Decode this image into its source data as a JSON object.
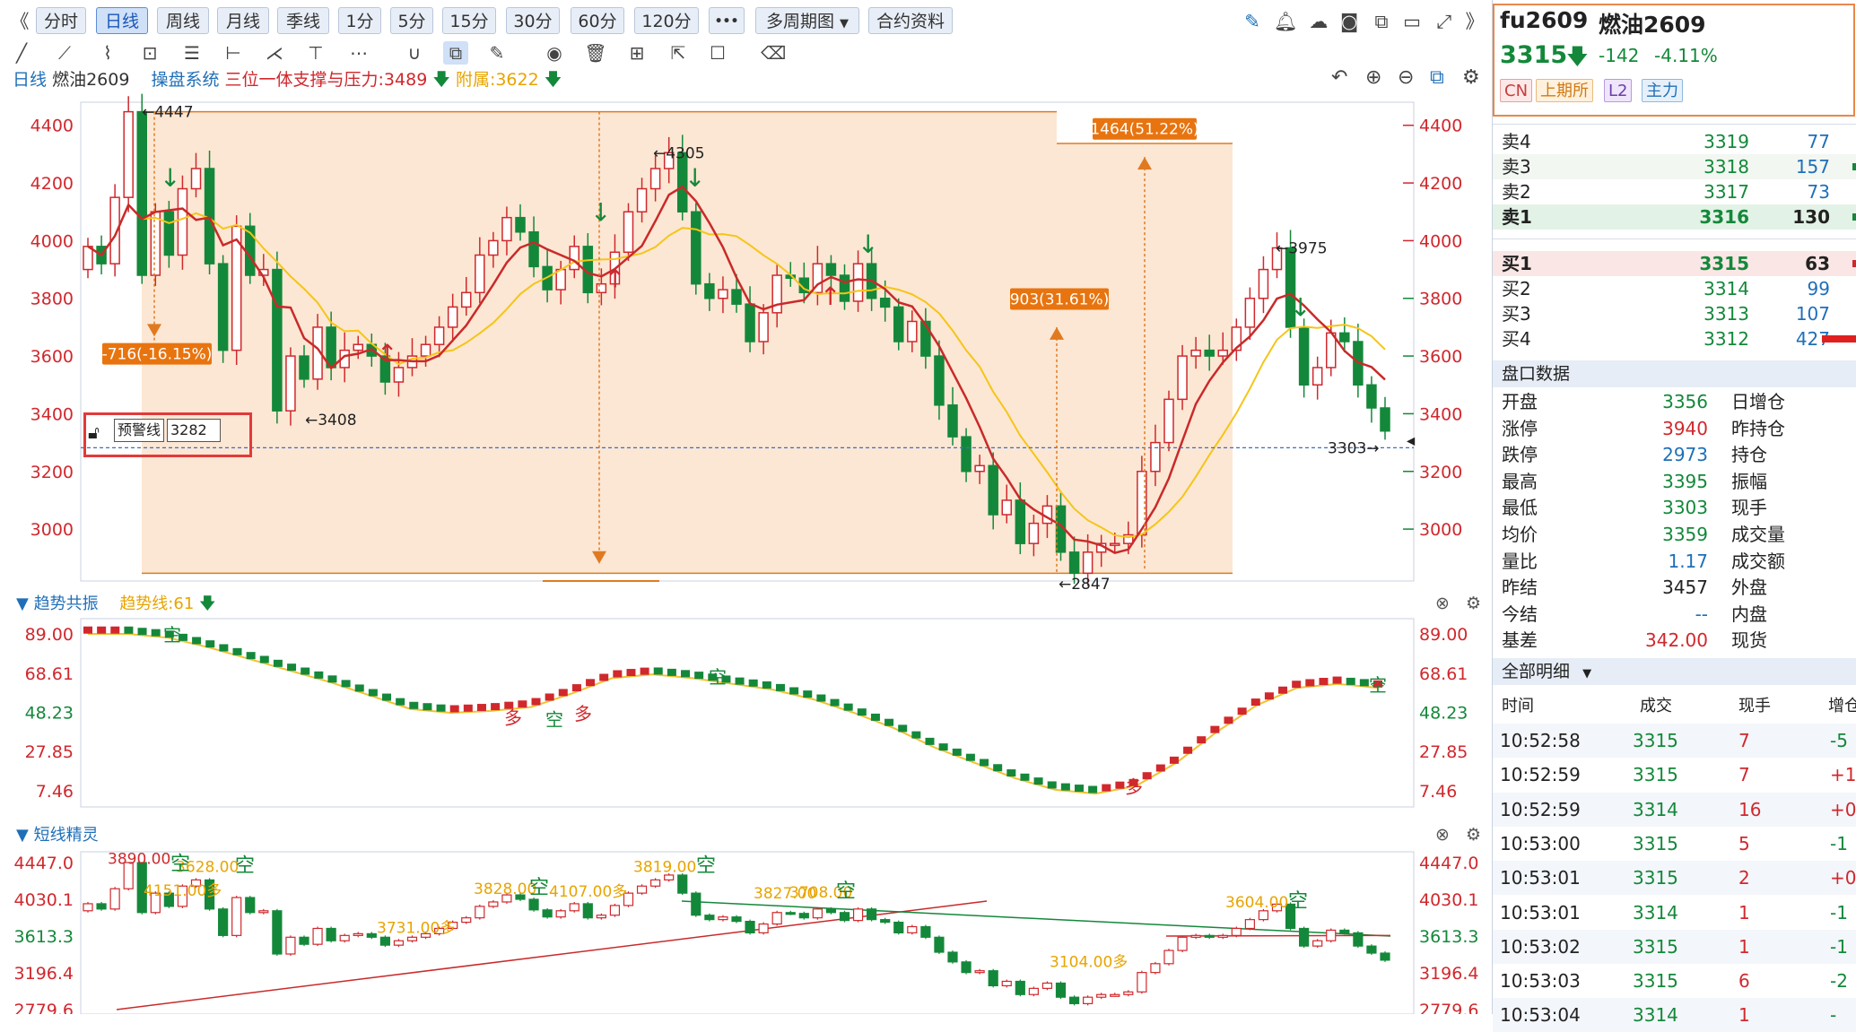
{
  "toolbar": {
    "collapse": "《",
    "periods": [
      "分时",
      "日线",
      "周线",
      "月线",
      "季线",
      "1分",
      "5分",
      "15分",
      "30分",
      "60分",
      "120分"
    ],
    "more": "•••",
    "multi_period": "多周期图",
    "contract_info": "合约资料",
    "expand": "》"
  },
  "info": {
    "period": "日线",
    "name": "燃油2609",
    "system": "操盘系统",
    "indicator": "三位一体支撑与压力:3489",
    "aux": "附属:3622"
  },
  "main_chart": {
    "y_ticks": [
      "4400",
      "4200",
      "4000",
      "3800",
      "3600",
      "3400",
      "3200",
      "3000"
    ],
    "labels": {
      "high_left": "←4447",
      "peak_mid": "←4305",
      "low_left": "←3408",
      "low_bottom": "←2847",
      "high_right": "←3975",
      "last": "3303→",
      "drop_box": "-716(-16.15%)",
      "rise_small": "903(31.61%)",
      "rise_big": "1464(51.22%)"
    },
    "alert": {
      "label": "预警线",
      "value": "3282"
    }
  },
  "chart_data": [
    {
      "type": "candlestick",
      "title": "",
      "ylim": [
        2820,
        4480
      ],
      "y_ticks": [
        4400,
        4200,
        4000,
        3800,
        3600,
        3400,
        3200,
        3000
      ],
      "annotations": {
        "high": 4447,
        "mid_peak": 4305,
        "low1": 3408,
        "low": 2847,
        "right_high": 3975,
        "last": 3303,
        "alert_line": 3282
      }
    },
    {
      "type": "line",
      "title": "趋势共振",
      "ylim": [
        0,
        96
      ],
      "y_ticks": [
        89.0,
        68.61,
        48.23,
        27.85,
        7.46
      ],
      "series": [
        {
          "name": "趋势线",
          "values": [
            89,
            89,
            87,
            82,
            76,
            70,
            64,
            57,
            50,
            48,
            49,
            51,
            58,
            66,
            68,
            66,
            63,
            60,
            55,
            48,
            40,
            30,
            22,
            14,
            8,
            6,
            10,
            22,
            38,
            52,
            61,
            63,
            61
          ]
        }
      ]
    },
    {
      "type": "candlestick",
      "title": "短线精灵",
      "ylim": [
        2779.6,
        4447.0
      ],
      "y_ticks": [
        4447.0,
        4030.1,
        3613.3,
        3196.4,
        2779.6
      ]
    }
  ],
  "trend_panel": {
    "title": "趋势共振",
    "trend_line": "趋势线:61",
    "y_ticks": [
      "89.00",
      "68.61",
      "48.23",
      "27.85",
      "7.46"
    ],
    "marks": [
      "空",
      "多",
      "空",
      "多",
      "空",
      "多",
      "空"
    ]
  },
  "short_panel": {
    "title": "短线精灵",
    "y_ticks": [
      "4447.0",
      "4030.1",
      "3613.3",
      "3196.4",
      "2779.6"
    ],
    "labels": [
      "3890.00",
      "3628.00",
      "空",
      "空",
      "4151.00多",
      "3828.00",
      "空",
      "3731.00多",
      "4107.00多",
      "3819.00",
      "空",
      "3827.00",
      "3708.00",
      "空",
      "3604.00",
      "空",
      "3104.00多"
    ]
  },
  "quote": {
    "code": "fu2609",
    "name": "燃油2609",
    "price": "3315",
    "change": "-142",
    "pct": "-4.11%",
    "tags": [
      "CN",
      "上期所",
      "L2",
      "主力"
    ]
  },
  "orderbook": {
    "asks": [
      {
        "label": "卖4",
        "price": "3319",
        "vol": "77"
      },
      {
        "label": "卖3",
        "price": "3318",
        "vol": "157"
      },
      {
        "label": "卖2",
        "price": "3317",
        "vol": "73"
      },
      {
        "label": "卖1",
        "price": "3316",
        "vol": "130"
      }
    ],
    "bids": [
      {
        "label": "买1",
        "price": "3315",
        "vol": "63"
      },
      {
        "label": "买2",
        "price": "3314",
        "vol": "99"
      },
      {
        "label": "买3",
        "price": "3313",
        "vol": "107"
      },
      {
        "label": "买4",
        "price": "3312",
        "vol": "427"
      }
    ]
  },
  "stats": {
    "title": "盘口数据",
    "rows": [
      {
        "k": "开盘",
        "v": "3356",
        "k2": "日增仓"
      },
      {
        "k": "涨停",
        "v": "3940",
        "k2": "昨持仓"
      },
      {
        "k": "跌停",
        "v": "2973",
        "k2": "持仓"
      },
      {
        "k": "最高",
        "v": "3395",
        "k2": "振幅"
      },
      {
        "k": "最低",
        "v": "3303",
        "k2": "现手"
      },
      {
        "k": "均价",
        "v": "3359",
        "k2": "成交量"
      },
      {
        "k": "量比",
        "v": "1.17",
        "k2": "成交额"
      },
      {
        "k": "昨结",
        "v": "3457",
        "k2": "外盘"
      },
      {
        "k": "今结",
        "v": "--",
        "k2": "内盘"
      },
      {
        "k": "基差",
        "v": "342.00",
        "k2": "现货"
      }
    ]
  },
  "ticks": {
    "title": "全部明细",
    "headers": [
      "时间",
      "成交",
      "现手",
      "增仓"
    ],
    "rows": [
      {
        "t": "10:52:58",
        "p": "3315",
        "v": "7",
        "d": "-5"
      },
      {
        "t": "10:52:59",
        "p": "3315",
        "v": "7",
        "d": "+1"
      },
      {
        "t": "10:52:59",
        "p": "3314",
        "v": "16",
        "d": "+0"
      },
      {
        "t": "10:53:00",
        "p": "3315",
        "v": "5",
        "d": "-1"
      },
      {
        "t": "10:53:01",
        "p": "3315",
        "v": "2",
        "d": "+0"
      },
      {
        "t": "10:53:01",
        "p": "3314",
        "v": "1",
        "d": "-1"
      },
      {
        "t": "10:53:02",
        "p": "3315",
        "v": "1",
        "d": "-1"
      },
      {
        "t": "10:53:03",
        "p": "3315",
        "v": "6",
        "d": "-2"
      },
      {
        "t": "10:53:04",
        "p": "3314",
        "v": "1",
        "d": "-"
      }
    ]
  }
}
